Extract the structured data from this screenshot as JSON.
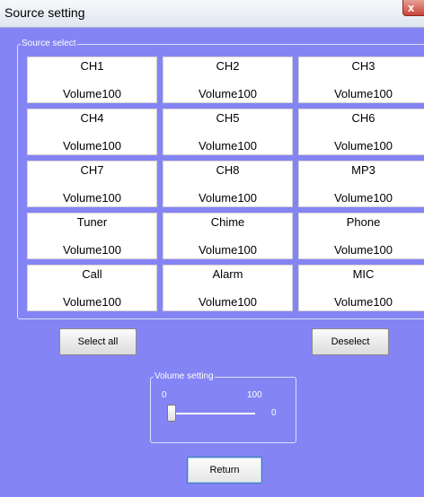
{
  "window": {
    "title": "Source setting",
    "close_label": "x"
  },
  "source_select": {
    "legend": "Source select",
    "buttons": [
      {
        "name": "CH1",
        "volume": "Volume100"
      },
      {
        "name": "CH2",
        "volume": "Volume100"
      },
      {
        "name": "CH3",
        "volume": "Volume100"
      },
      {
        "name": "CH4",
        "volume": "Volume100"
      },
      {
        "name": "CH5",
        "volume": "Volume100"
      },
      {
        "name": "CH6",
        "volume": "Volume100"
      },
      {
        "name": "CH7",
        "volume": "Volume100"
      },
      {
        "name": "CH8",
        "volume": "Volume100"
      },
      {
        "name": "MP3",
        "volume": "Volume100"
      },
      {
        "name": "Tuner",
        "volume": "Volume100"
      },
      {
        "name": "Chime",
        "volume": "Volume100"
      },
      {
        "name": "Phone",
        "volume": "Volume100"
      },
      {
        "name": "Call",
        "volume": "Volume100"
      },
      {
        "name": "Alarm",
        "volume": "Volume100"
      },
      {
        "name": "MIC",
        "volume": "Volume100"
      }
    ]
  },
  "actions": {
    "select_all": "Select all",
    "deselect": "Deselect",
    "return": "Return"
  },
  "volume_setting": {
    "legend": "Volume setting",
    "min_label": "0",
    "max_label": "100",
    "current_value": "0",
    "slider_min": 0,
    "slider_max": 100,
    "slider_value": 0
  },
  "colors": {
    "background": "#8484f4",
    "button_face": "#ffffff",
    "text_on_bg": "#ffffff"
  },
  "icons": {
    "close": "close-icon"
  }
}
